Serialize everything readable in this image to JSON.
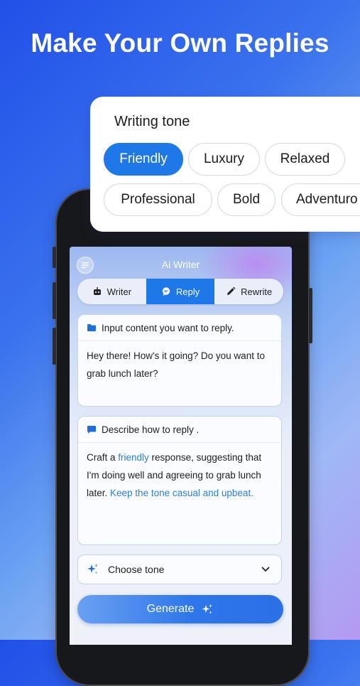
{
  "headline": "Make Your Own Replies",
  "tone_panel": {
    "title": "Writing tone",
    "chips": [
      {
        "label": "Friendly",
        "selected": true
      },
      {
        "label": "Luxury",
        "selected": false
      },
      {
        "label": "Relaxed",
        "selected": false
      },
      {
        "label": "Professional",
        "selected": false
      },
      {
        "label": "Bold",
        "selected": false
      },
      {
        "label": "Adventuro",
        "selected": false
      }
    ]
  },
  "app": {
    "title": "Ai Writer",
    "tabs": [
      {
        "label": "Writer",
        "icon": "robot-icon",
        "active": false
      },
      {
        "label": "Reply",
        "icon": "chat-bubble-icon",
        "active": true
      },
      {
        "label": "Rewrite",
        "icon": "pencil-icon",
        "active": false
      }
    ],
    "input_card": {
      "header": "Input content you want to reply.",
      "body": "Hey there! How's it going? Do you want to grab lunch later?"
    },
    "describe_card": {
      "header": "Describe how to reply .",
      "body_1": "Craft a ",
      "body_highlight_1": "friendly",
      "body_2": " response, suggesting that I'm doing well and agreeing to grab lunch later. ",
      "body_highlight_2": "Keep the tone casual and upbeat."
    },
    "choose_tone": "Choose tone",
    "generate": "Generate"
  },
  "colors": {
    "accent": "#1f78e8",
    "highlight_text": "#2a7fdc"
  }
}
